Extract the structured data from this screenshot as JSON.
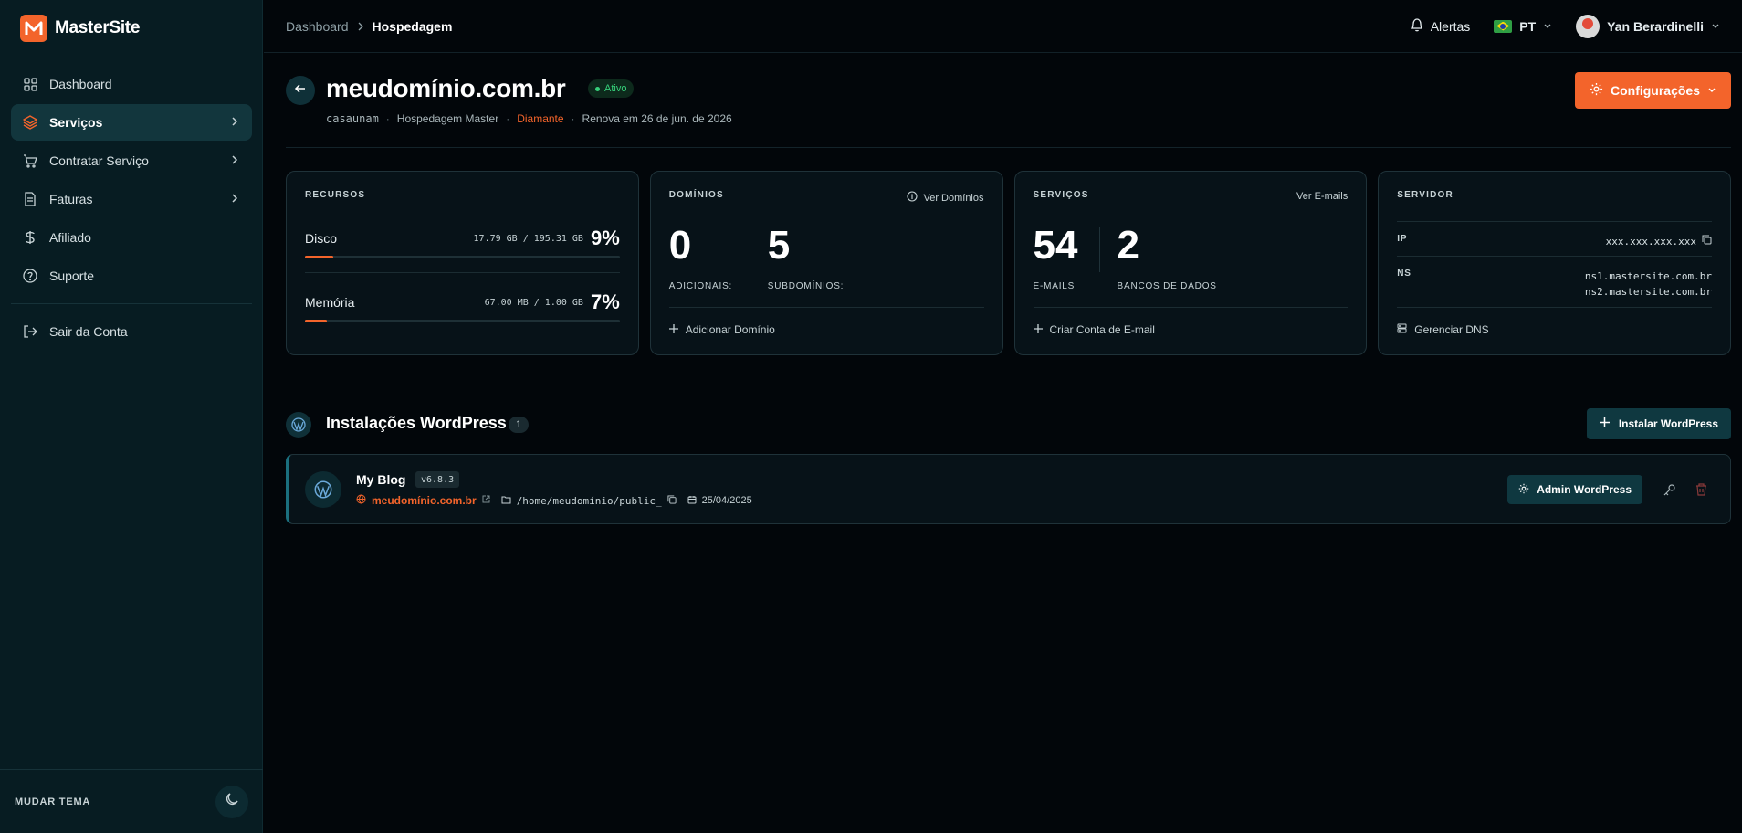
{
  "brand": {
    "name": "MasterSite",
    "accent": "#f3642b"
  },
  "sidebar": {
    "items": [
      {
        "label": "Dashboard",
        "icon": "grid-icon"
      },
      {
        "label": "Serviços",
        "icon": "layers-icon",
        "active": true
      },
      {
        "label": "Contratar Serviço",
        "icon": "cart-icon"
      },
      {
        "label": "Faturas",
        "icon": "document-icon"
      },
      {
        "label": "Afiliado",
        "icon": "dollar-icon"
      },
      {
        "label": "Suporte",
        "icon": "help-circle-icon"
      }
    ],
    "logout": "Sair da Conta",
    "theme_label": "MUDAR TEMA"
  },
  "topbar": {
    "breadcrumb": [
      "Dashboard",
      "Hospedagem"
    ],
    "alerts": "Alertas",
    "language": "PT",
    "user": "Yan Berardinelli"
  },
  "header": {
    "title": "meudomínio.com.br",
    "status": "Ativo",
    "sub": {
      "user": "casaunam",
      "plan": "Hospedagem Master",
      "tier": "Diamante",
      "renew": "Renova em 26 de jun. de 2026"
    },
    "config_button": "Configurações"
  },
  "cards": {
    "resources": {
      "title": "RECURSOS",
      "disk": {
        "label": "Disco",
        "value": "17.79 GB / 195.31 GB",
        "pct": "9%",
        "fill": 0.09
      },
      "memory": {
        "label": "Memória",
        "value": "67.00 MB / 1.00 GB",
        "pct": "7%",
        "fill": 0.07
      }
    },
    "domains": {
      "title": "DOMÍNIOS",
      "link": "Ver Domínios",
      "additional": {
        "value": "0",
        "label": "ADICIONAIS:"
      },
      "subdomains": {
        "value": "5",
        "label": "SUBDOMÍNIOS:"
      },
      "action": "Adicionar Domínio"
    },
    "services": {
      "title": "SERVIÇOS",
      "link": "Ver E-mails",
      "emails": {
        "value": "54",
        "label": "E-MAILS"
      },
      "databases": {
        "value": "2",
        "label": "BANCOS DE DADOS"
      },
      "action": "Criar Conta de E-mail"
    },
    "server": {
      "title": "SERVIDOR",
      "ip_label": "IP",
      "ip": "xxx.xxx.xxx.xxx",
      "ns_label": "NS",
      "ns1": "ns1.mastersite.com.br",
      "ns2": "ns2.mastersite.com.br",
      "action": "Gerenciar DNS"
    }
  },
  "wordpress": {
    "title": "Instalações WordPress",
    "count": "1",
    "install_button": "Instalar WordPress",
    "items": [
      {
        "name": "My Blog",
        "version": "v6.8.3",
        "domain": "meudomínio.com.br",
        "path": "/home/meudomínio/public_",
        "date": "25/04/2025",
        "admin_button": "Admin WordPress"
      }
    ]
  }
}
